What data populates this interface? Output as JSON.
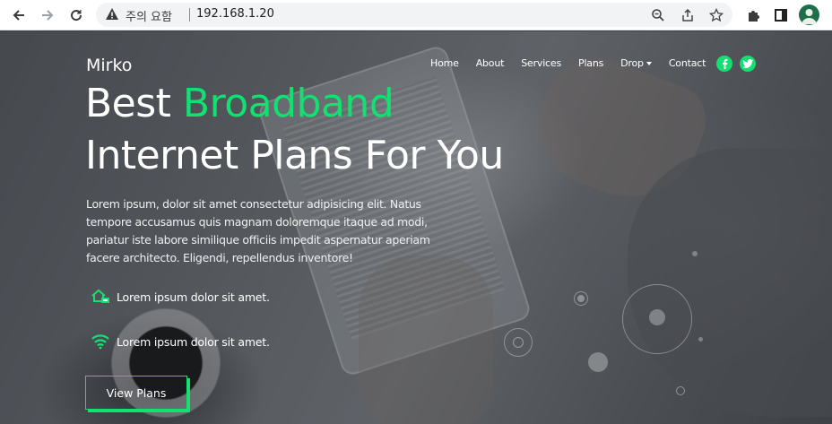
{
  "browser": {
    "security_label": "주의 요함",
    "url": "192.168.1.20"
  },
  "site": {
    "brand": "Mirko",
    "nav": [
      {
        "label": "Home"
      },
      {
        "label": "About"
      },
      {
        "label": "Services"
      },
      {
        "label": "Plans"
      },
      {
        "label": "Drop"
      },
      {
        "label": "Contact"
      }
    ],
    "social": {
      "facebook": "f",
      "twitter": "t"
    }
  },
  "hero": {
    "headline_line1_a": "Best ",
    "headline_line1_b": "Broadband",
    "headline_line2": "Internet Plans For You",
    "paragraph": "Lorem ipsum, dolor sit amet consectetur adipisicing elit. Natus tempore accusamus quis magnam doloremque itaque ad modi, pariatur iste labore similique officiis impedit aspernatur aperiam facere architecto. Eligendi, repellendus inventore!",
    "features": [
      {
        "icon": "home-network-icon",
        "text": "Lorem ipsum dolor sit amet."
      },
      {
        "icon": "wifi-icon",
        "text": "Lorem ipsum dolor sit amet."
      }
    ],
    "cta_label": "View Plans"
  },
  "colors": {
    "accent": "#12e071",
    "text": "#ffffff"
  }
}
